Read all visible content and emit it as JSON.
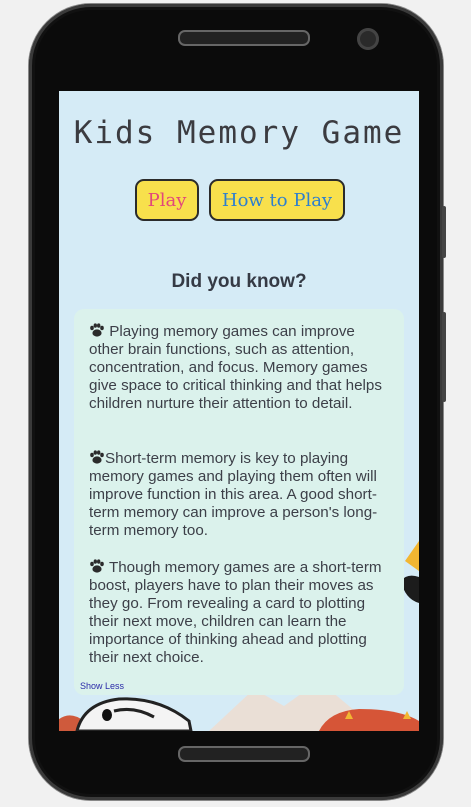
{
  "app": {
    "title": "Kids Memory Game",
    "buttons": {
      "play": "Play",
      "how_to_play": "How to Play"
    }
  },
  "facts": {
    "heading": "Did you know?",
    "items": [
      "Playing memory games can improve other brain functions, such as attention, concentration, and focus. Memory games give space to critical thinking and that helps children nurture their attention to detail.",
      "Short-term memory is key to playing memory games and playing them often will improve function in this area. A good short-term memory can improve a person's long-term memory too.",
      "Though memory games are a short-term boost, players have to plan their moves as they go. From revealing a card to plotting their next move, children can learn the importance of thinking ahead and plotting their next choice."
    ],
    "toggle_label": "Show Less"
  },
  "colors": {
    "screen_bg": "#d5ebf6",
    "card_bg": "#dbf2ec",
    "button_bg": "#f8e04c",
    "play_text": "#e2477b",
    "how_to_text": "#2d7fcf"
  },
  "icons": [
    "paw-icon"
  ]
}
